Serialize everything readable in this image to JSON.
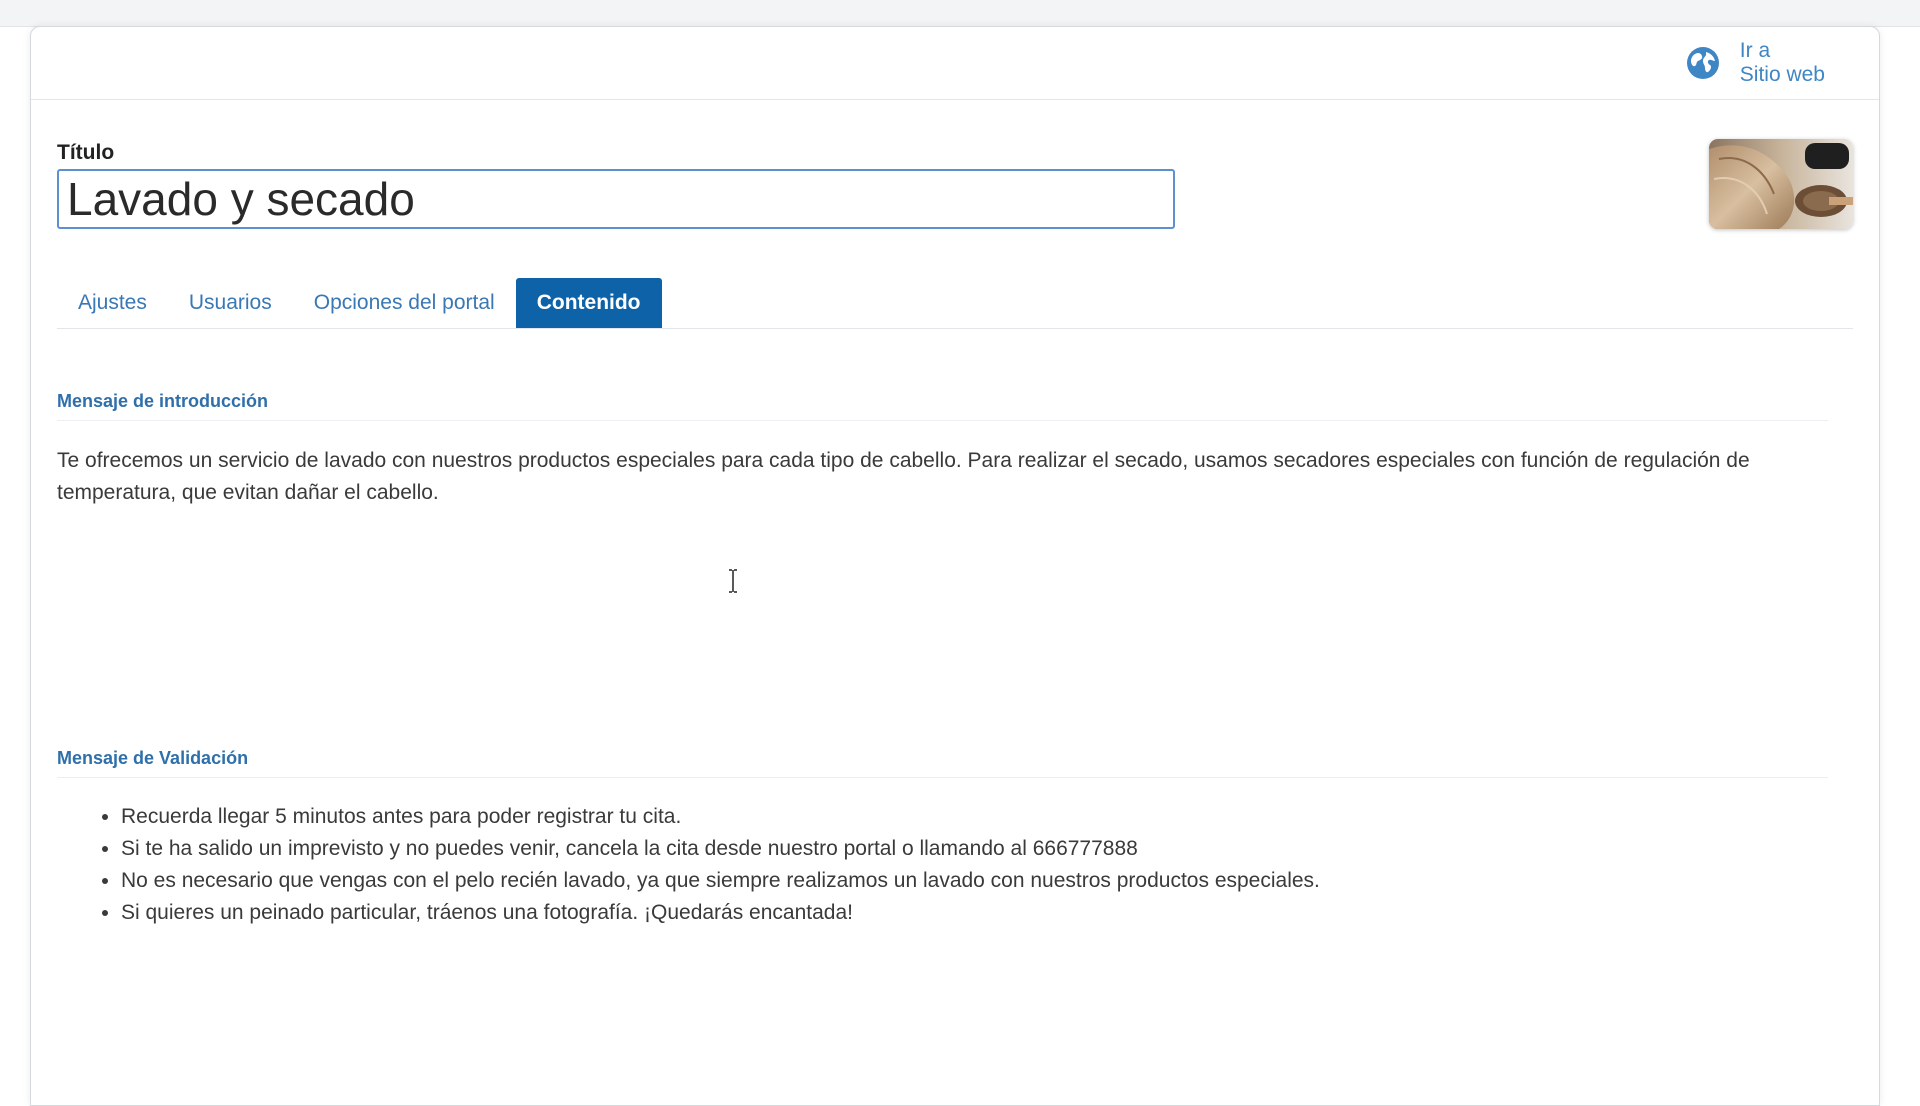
{
  "header": {
    "website_link_line1": "Ir a",
    "website_link_line2": "Sitio web",
    "website_icon": "globe-icon"
  },
  "form": {
    "title_label": "Título",
    "title_value": "Lavado y secado",
    "thumbnail_alt": "hair-drying-photo"
  },
  "tabs": [
    {
      "label": "Ajustes",
      "active": false
    },
    {
      "label": "Usuarios",
      "active": false
    },
    {
      "label": "Opciones del portal",
      "active": false
    },
    {
      "label": "Contenido",
      "active": true
    }
  ],
  "intro": {
    "heading": "Mensaje de introducción",
    "text": "Te ofrecemos un servicio de lavado con nuestros productos especiales para cada tipo de cabello. Para realizar el secado, usamos secadores especiales con función de regulación de temperatura, que evitan dañar el cabello."
  },
  "validation": {
    "heading": "Mensaje de Validación",
    "items": [
      "Recuerda llegar 5 minutos antes para poder registrar tu cita.",
      "Si te ha salido un imprevisto y no puedes venir, cancela la cita desde nuestro portal o llamando al 666777888",
      "No es necesario que vengas con el pelo recién lavado, ya que siempre realizamos un lavado con nuestros productos especiales.",
      "Si quieres un peinado particular, tráenos una fotografía. ¡Quedarás encantada!"
    ]
  },
  "colors": {
    "accent": "#0e63a8",
    "link": "#3a78b5",
    "heading": "#2f6faa"
  }
}
